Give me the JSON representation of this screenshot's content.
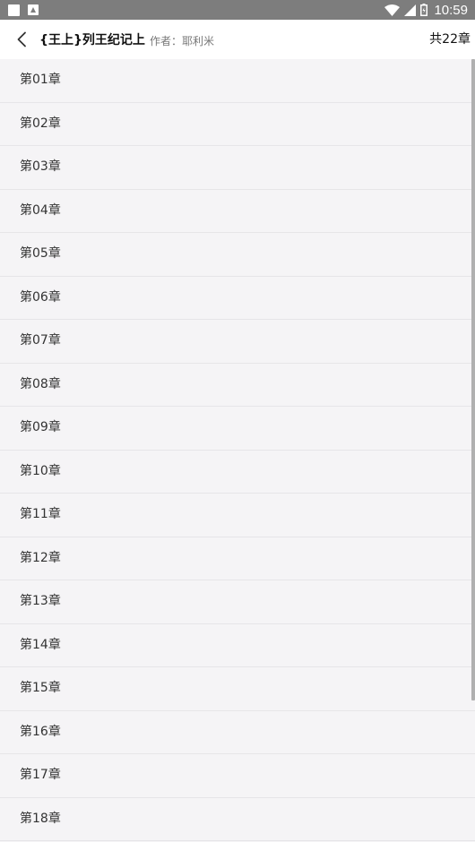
{
  "status_bar": {
    "time": "10:59",
    "icons": [
      "square-notification-icon",
      "a-notification-icon",
      "wifi-icon",
      "signal-icon",
      "battery-icon"
    ]
  },
  "header": {
    "title": "{王上}列王纪记上",
    "author": "作者：耶利米",
    "total": "共22章",
    "back_icon": "chevron-left-icon"
  },
  "chapters": [
    "第01章",
    "第02章",
    "第03章",
    "第04章",
    "第05章",
    "第06章",
    "第07章",
    "第08章",
    "第09章",
    "第10章",
    "第11章",
    "第12章",
    "第13章",
    "第14章",
    "第15章",
    "第16章",
    "第17章",
    "第18章"
  ],
  "colors": {
    "status_bar": "#7d7d7d",
    "list_background": "#f5f4f6",
    "divider": "#e6e5e8"
  }
}
